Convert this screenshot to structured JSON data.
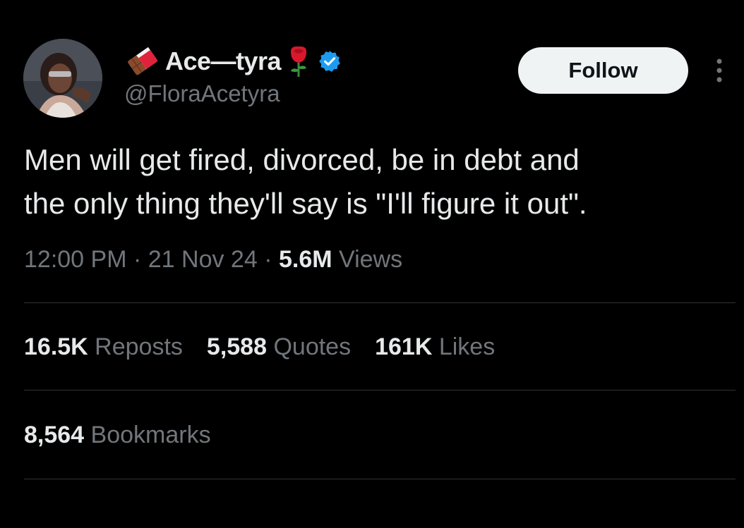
{
  "author": {
    "display_name": "Ace—tyra",
    "handle": "@FloraAcetyra",
    "avatar_icon": "profile-photo",
    "name_icons": [
      "chocolate-bar-icon",
      "rose-icon",
      "verified-badge-icon"
    ],
    "verified_color": "#1d9bf0"
  },
  "actions": {
    "follow_label": "Follow",
    "more_icon": "more-vertical-icon"
  },
  "tweet": {
    "line1": "Men will get fired, divorced, be in debt and",
    "line2": "the only thing they'll say is \"I'll figure it out\"."
  },
  "meta": {
    "time": "12:00 PM",
    "sep1": " · ",
    "date": "21 Nov 24",
    "sep2": " · ",
    "views_count": "5.6M",
    "views_label": " Views"
  },
  "stats": {
    "reposts_count": "16.5K",
    "reposts_label": " Reposts",
    "quotes_count": "5,588",
    "quotes_label": " Quotes",
    "likes_count": "161K",
    "likes_label": " Likes",
    "bookmarks_count": "8,564",
    "bookmarks_label": " Bookmarks"
  },
  "colors": {
    "background": "#000000",
    "primary_text": "#e7e9ea",
    "secondary_text": "#71767b",
    "divider": "#2f3336",
    "follow_bg": "#eff3f4"
  }
}
